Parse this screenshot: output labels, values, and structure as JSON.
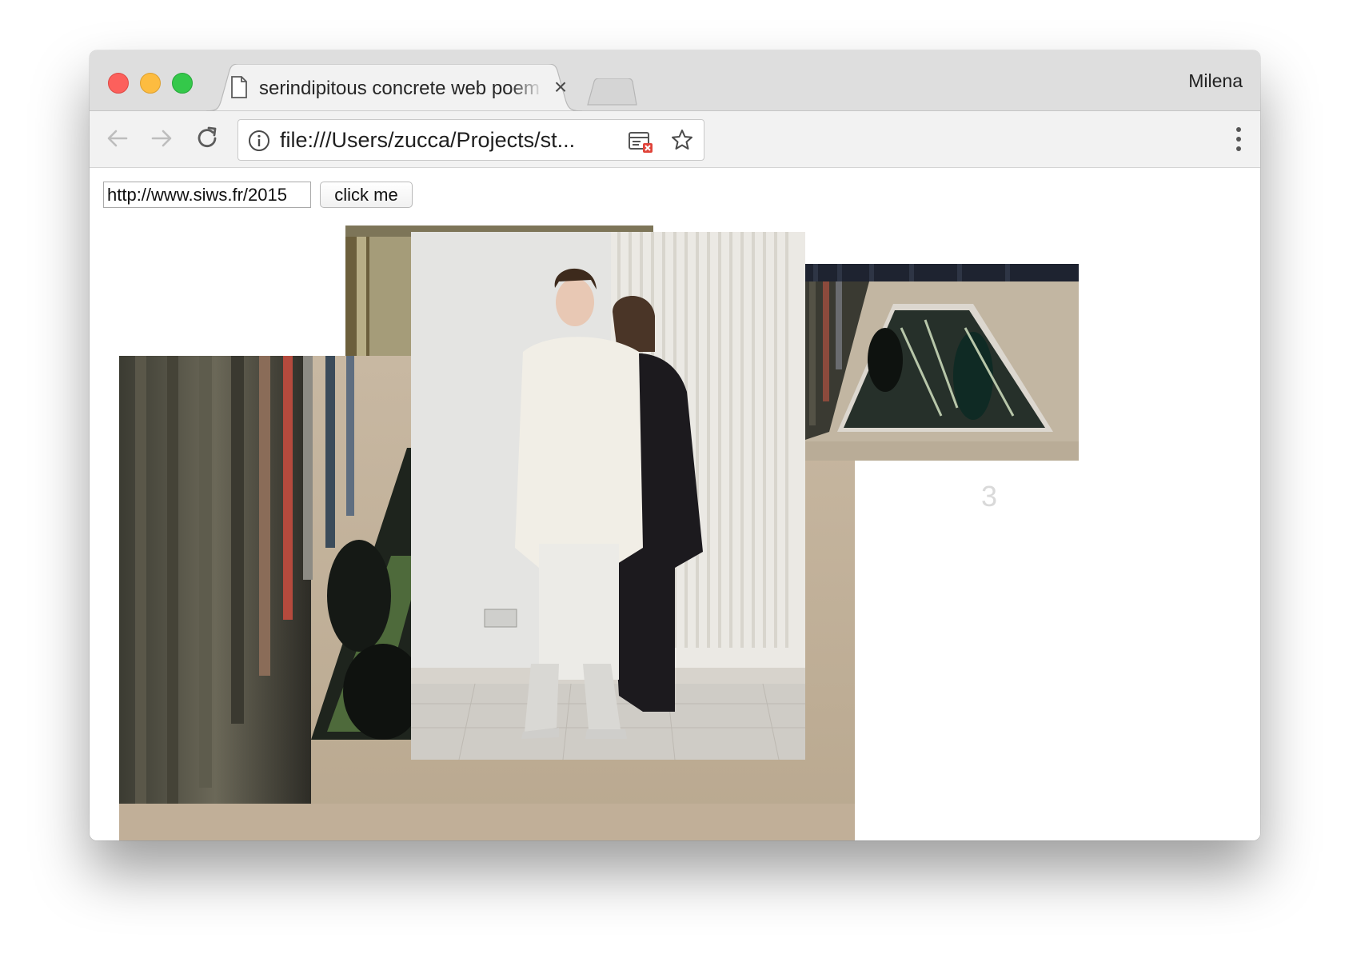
{
  "browser": {
    "tab_title": "serindipitous concrete web poem",
    "tab_close": "×",
    "profile_name": "Milena",
    "url": "file:///Users/zucca/Projects/st..."
  },
  "page": {
    "url_input_value": "http://www.siws.fr/2015",
    "button_label": "click me",
    "image_caption_number": "3"
  },
  "photos": [
    {
      "name": "gallery-curtains-photo-top",
      "description_icon": "image"
    },
    {
      "name": "gallery-floor-foliage-photo",
      "description_icon": "image"
    },
    {
      "name": "couple-portrait-photo",
      "description_icon": "image"
    },
    {
      "name": "gallery-floor-foliage-photo-small",
      "description_icon": "image"
    }
  ],
  "colors": {
    "close": "#fc605c",
    "minimize": "#fdbc40",
    "maximize": "#34c84a",
    "tabbar": "#dedede",
    "toolbar": "#f2f2f2"
  }
}
